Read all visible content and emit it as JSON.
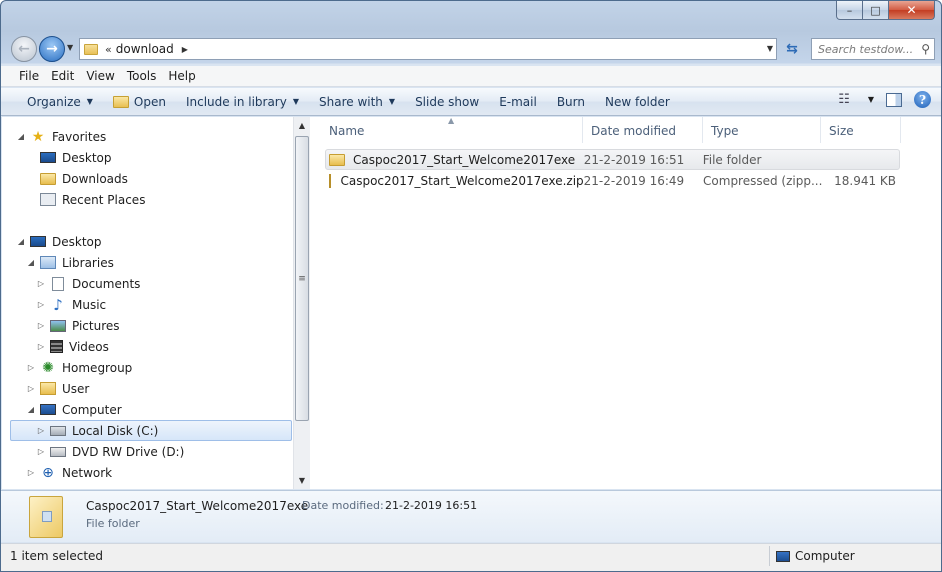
{
  "window": {
    "caption_min": "–",
    "caption_max": "□",
    "caption_close": "✕"
  },
  "navbar": {
    "back_glyph": "←",
    "forward_glyph": "→",
    "address_chevron": "«",
    "address_path": "download",
    "address_arrow": "▶",
    "refresh_glyph": "⇆",
    "search_placeholder": "Search testdow..."
  },
  "menubar": {
    "items": [
      "File",
      "Edit",
      "View",
      "Tools",
      "Help"
    ]
  },
  "toolbar": {
    "organize": "Organize",
    "open": "Open",
    "include_in_library": "Include in library",
    "share_with": "Share with",
    "slide_show": "Slide show",
    "email": "E-mail",
    "burn": "Burn",
    "new_folder": "New folder",
    "help": "?"
  },
  "navpane": {
    "favorites": "Favorites",
    "desktop_fav": "Desktop",
    "downloads": "Downloads",
    "recent_places": "Recent Places",
    "desktop": "Desktop",
    "libraries": "Libraries",
    "documents": "Documents",
    "music": "Music",
    "pictures": "Pictures",
    "videos": "Videos",
    "homegroup": "Homegroup",
    "user": "User",
    "computer": "Computer",
    "local_disk": "Local Disk (C:)",
    "dvd_drive": "DVD RW Drive (D:)",
    "network": "Network"
  },
  "content": {
    "columns": {
      "name": "Name",
      "date_modified": "Date modified",
      "type": "Type",
      "size": "Size"
    },
    "rows": [
      {
        "name": "Caspoc2017_Start_Welcome2017exe",
        "date": "21-2-2019 16:51",
        "type": "File folder",
        "size": "",
        "icon": "folder-icon",
        "selected": true
      },
      {
        "name": "Caspoc2017_Start_Welcome2017exe.zip",
        "date": "21-2-2019 16:49",
        "type": "Compressed (zipp...",
        "size": "18.941 KB",
        "icon": "zip-icon",
        "selected": false
      }
    ]
  },
  "details": {
    "name": "Caspoc2017_Start_Welcome2017exe",
    "date_label": "Date modified:",
    "date_value": "21-2-2019 16:51",
    "type": "File folder"
  },
  "statusbar": {
    "selection": "1 item selected",
    "location": "Computer"
  },
  "colors": {
    "accent": "#2a6fc2",
    "selection_border": "#9ebee8"
  }
}
